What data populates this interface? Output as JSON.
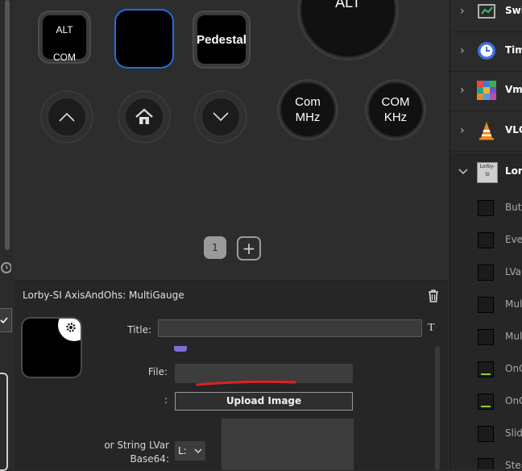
{
  "canvas": {
    "keys": {
      "alt_com": {
        "line1": "ALT",
        "line2": "COM"
      },
      "pedestal": "Pedestal"
    },
    "knobs": {
      "top_partial": "ALT",
      "com_mhz": {
        "line1": "Com",
        "line2": "MHz"
      },
      "com_khz": {
        "line1": "COM",
        "line2": "KHz"
      }
    },
    "pages": {
      "current": "1",
      "add": "+"
    }
  },
  "properties": {
    "header": "Lorby-SI AxisAndOhs: MultiGauge",
    "title_label": "Title:",
    "title_value": "",
    "title_icon": "T",
    "file_label": "File:",
    "file_value": "",
    "colon_label": ":",
    "upload_button": "Upload Image",
    "lvar_label_line1": "or String LVar",
    "lvar_label_line2": "Base64:",
    "lvar_prefix": "L:",
    "icons": [
      "delete-icon",
      "gear-icon",
      "font-icon",
      "chevron-down-icon"
    ]
  },
  "sidebar": {
    "categories": [
      {
        "label": "Swi",
        "icon": "switch-icon"
      },
      {
        "label": "Tim",
        "icon": "clock-icon"
      },
      {
        "label": "Vmi",
        "icon": "grid-icon"
      },
      {
        "label": "VLC",
        "icon": "vlc-cone-icon"
      },
      {
        "label": "Lor",
        "icon": "lorby-logo-icon",
        "expanded": true,
        "logo_text": "Lorby-SI"
      }
    ],
    "actions": [
      "Butt",
      "Ever",
      "LVar",
      "Mult",
      "Mult",
      "OnC",
      "OnC",
      "Slid",
      "Stea"
    ]
  },
  "colors": {
    "selected_border": "#1e6fd9",
    "annotation_red": "#e02020"
  }
}
